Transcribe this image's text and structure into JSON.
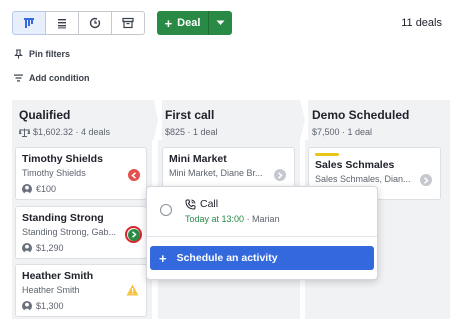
{
  "toolbar": {
    "views": [
      {
        "icon": "pipeline-view-icon",
        "active": true
      },
      {
        "icon": "list-view-icon",
        "active": false
      },
      {
        "icon": "forecast-view-icon",
        "active": false
      },
      {
        "icon": "archive-icon",
        "active": false
      }
    ],
    "deal_button_label": "Deal",
    "deal_count": "11 deals"
  },
  "filters": {
    "pin_filters": "Pin filters",
    "add_condition": "Add condition"
  },
  "columns": [
    {
      "title": "Qualified",
      "summary": "$1,602.32 · 4 deals",
      "cards": [
        {
          "title": "Timothy Shields",
          "subtitle": "Timothy Shields",
          "value": "€100",
          "status": "overdue",
          "status_color": "#e2504f"
        },
        {
          "title": "Standing Strong",
          "subtitle": "Standing Strong, Gab...",
          "value": "$1,290",
          "status": "scheduled",
          "status_color": "#298a46"
        },
        {
          "title": "Heather Smith",
          "subtitle": "Heather Smith",
          "value": "$1,300",
          "status": "warning",
          "status_color": "#f6c343"
        }
      ]
    },
    {
      "title": "First call",
      "summary": "$825 · 1 deal",
      "cards": [
        {
          "title": "Mini Market",
          "subtitle": "Mini Market, Diane Br...",
          "status": "no-activity"
        }
      ]
    },
    {
      "title": "Demo Scheduled",
      "summary": "$7,500 · 1 deal",
      "cards": [
        {
          "title": "Sales Schmales",
          "subtitle": "Sales Schmales, Dian...",
          "status": "no-activity",
          "accent": "#e6c716"
        }
      ]
    }
  ],
  "popup": {
    "activity_title": "Call",
    "activity_time": "Today at 13:00",
    "activity_person": "· Marian",
    "schedule_label": "Schedule an activity"
  }
}
